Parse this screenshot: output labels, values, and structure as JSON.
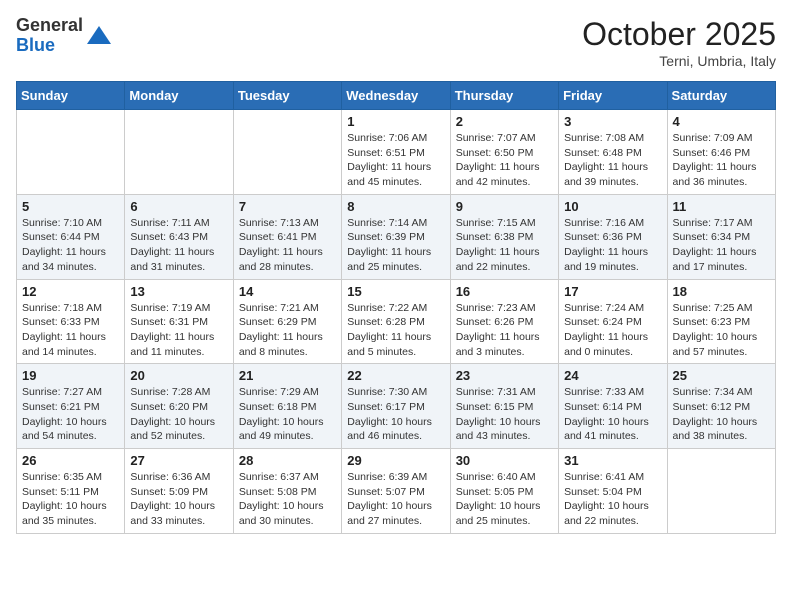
{
  "logo": {
    "general": "General",
    "blue": "Blue"
  },
  "header": {
    "month": "October 2025",
    "location": "Terni, Umbria, Italy"
  },
  "weekdays": [
    "Sunday",
    "Monday",
    "Tuesday",
    "Wednesday",
    "Thursday",
    "Friday",
    "Saturday"
  ],
  "weeks": [
    [
      {
        "day": "",
        "info": ""
      },
      {
        "day": "",
        "info": ""
      },
      {
        "day": "",
        "info": ""
      },
      {
        "day": "1",
        "info": "Sunrise: 7:06 AM\nSunset: 6:51 PM\nDaylight: 11 hours and 45 minutes."
      },
      {
        "day": "2",
        "info": "Sunrise: 7:07 AM\nSunset: 6:50 PM\nDaylight: 11 hours and 42 minutes."
      },
      {
        "day": "3",
        "info": "Sunrise: 7:08 AM\nSunset: 6:48 PM\nDaylight: 11 hours and 39 minutes."
      },
      {
        "day": "4",
        "info": "Sunrise: 7:09 AM\nSunset: 6:46 PM\nDaylight: 11 hours and 36 minutes."
      }
    ],
    [
      {
        "day": "5",
        "info": "Sunrise: 7:10 AM\nSunset: 6:44 PM\nDaylight: 11 hours and 34 minutes."
      },
      {
        "day": "6",
        "info": "Sunrise: 7:11 AM\nSunset: 6:43 PM\nDaylight: 11 hours and 31 minutes."
      },
      {
        "day": "7",
        "info": "Sunrise: 7:13 AM\nSunset: 6:41 PM\nDaylight: 11 hours and 28 minutes."
      },
      {
        "day": "8",
        "info": "Sunrise: 7:14 AM\nSunset: 6:39 PM\nDaylight: 11 hours and 25 minutes."
      },
      {
        "day": "9",
        "info": "Sunrise: 7:15 AM\nSunset: 6:38 PM\nDaylight: 11 hours and 22 minutes."
      },
      {
        "day": "10",
        "info": "Sunrise: 7:16 AM\nSunset: 6:36 PM\nDaylight: 11 hours and 19 minutes."
      },
      {
        "day": "11",
        "info": "Sunrise: 7:17 AM\nSunset: 6:34 PM\nDaylight: 11 hours and 17 minutes."
      }
    ],
    [
      {
        "day": "12",
        "info": "Sunrise: 7:18 AM\nSunset: 6:33 PM\nDaylight: 11 hours and 14 minutes."
      },
      {
        "day": "13",
        "info": "Sunrise: 7:19 AM\nSunset: 6:31 PM\nDaylight: 11 hours and 11 minutes."
      },
      {
        "day": "14",
        "info": "Sunrise: 7:21 AM\nSunset: 6:29 PM\nDaylight: 11 hours and 8 minutes."
      },
      {
        "day": "15",
        "info": "Sunrise: 7:22 AM\nSunset: 6:28 PM\nDaylight: 11 hours and 5 minutes."
      },
      {
        "day": "16",
        "info": "Sunrise: 7:23 AM\nSunset: 6:26 PM\nDaylight: 11 hours and 3 minutes."
      },
      {
        "day": "17",
        "info": "Sunrise: 7:24 AM\nSunset: 6:24 PM\nDaylight: 11 hours and 0 minutes."
      },
      {
        "day": "18",
        "info": "Sunrise: 7:25 AM\nSunset: 6:23 PM\nDaylight: 10 hours and 57 minutes."
      }
    ],
    [
      {
        "day": "19",
        "info": "Sunrise: 7:27 AM\nSunset: 6:21 PM\nDaylight: 10 hours and 54 minutes."
      },
      {
        "day": "20",
        "info": "Sunrise: 7:28 AM\nSunset: 6:20 PM\nDaylight: 10 hours and 52 minutes."
      },
      {
        "day": "21",
        "info": "Sunrise: 7:29 AM\nSunset: 6:18 PM\nDaylight: 10 hours and 49 minutes."
      },
      {
        "day": "22",
        "info": "Sunrise: 7:30 AM\nSunset: 6:17 PM\nDaylight: 10 hours and 46 minutes."
      },
      {
        "day": "23",
        "info": "Sunrise: 7:31 AM\nSunset: 6:15 PM\nDaylight: 10 hours and 43 minutes."
      },
      {
        "day": "24",
        "info": "Sunrise: 7:33 AM\nSunset: 6:14 PM\nDaylight: 10 hours and 41 minutes."
      },
      {
        "day": "25",
        "info": "Sunrise: 7:34 AM\nSunset: 6:12 PM\nDaylight: 10 hours and 38 minutes."
      }
    ],
    [
      {
        "day": "26",
        "info": "Sunrise: 6:35 AM\nSunset: 5:11 PM\nDaylight: 10 hours and 35 minutes."
      },
      {
        "day": "27",
        "info": "Sunrise: 6:36 AM\nSunset: 5:09 PM\nDaylight: 10 hours and 33 minutes."
      },
      {
        "day": "28",
        "info": "Sunrise: 6:37 AM\nSunset: 5:08 PM\nDaylight: 10 hours and 30 minutes."
      },
      {
        "day": "29",
        "info": "Sunrise: 6:39 AM\nSunset: 5:07 PM\nDaylight: 10 hours and 27 minutes."
      },
      {
        "day": "30",
        "info": "Sunrise: 6:40 AM\nSunset: 5:05 PM\nDaylight: 10 hours and 25 minutes."
      },
      {
        "day": "31",
        "info": "Sunrise: 6:41 AM\nSunset: 5:04 PM\nDaylight: 10 hours and 22 minutes."
      },
      {
        "day": "",
        "info": ""
      }
    ]
  ]
}
